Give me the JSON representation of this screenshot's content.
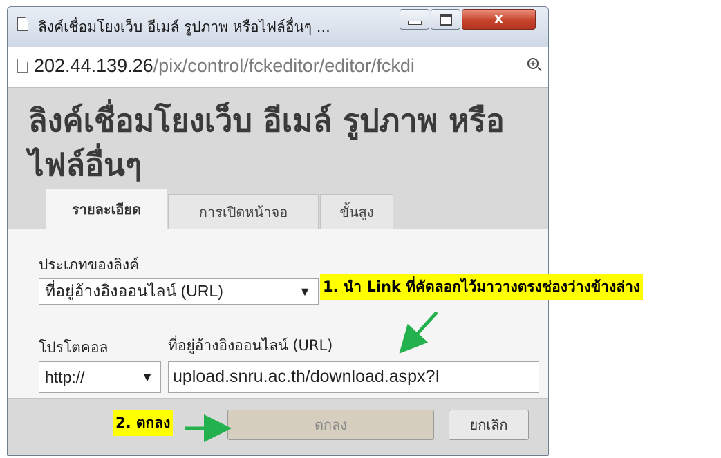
{
  "window": {
    "title": "ลิงค์เชื่อมโยงเว็บ อีเมล์ รูปภาพ หรือไฟล์อื่นๆ ...",
    "url_host": "202.44.139.26",
    "url_path": "/pix/control/fckeditor/editor/fckdi"
  },
  "dialog": {
    "heading": "ลิงค์เชื่อมโยงเว็บ อีเมล์ รูปภาพ หรือไฟล์อื่นๆ",
    "tabs": [
      {
        "label": "รายละเอียด",
        "active": true
      },
      {
        "label": "การเปิดหน้าจอ",
        "active": false
      },
      {
        "label": "ขั้นสูง",
        "active": false
      }
    ],
    "link_type_label": "ประเภทของลิงค์",
    "link_type_value": "ที่อยู่อ้างอิงออนไลน์ (URL)",
    "protocol_label": "โปรโตคอล",
    "protocol_value": "http://",
    "url_label": "ที่อยู่อ้างอิงออนไลน์ (URL)",
    "url_value": "upload.snru.ac.th/download.aspx?I",
    "ok_label": "ตกลง",
    "cancel_label": "ยกเลิก"
  },
  "annotations": {
    "step1": "1. นำ Link ที่คัดลอกไว้มาวางตรงช่องว่างข้างล่าง",
    "step2": "2. ตกลง",
    "arrow_color": "#22b14c",
    "highlight_color": "#ffff00"
  },
  "icons": {
    "dropdown": "▼",
    "close": "X"
  }
}
